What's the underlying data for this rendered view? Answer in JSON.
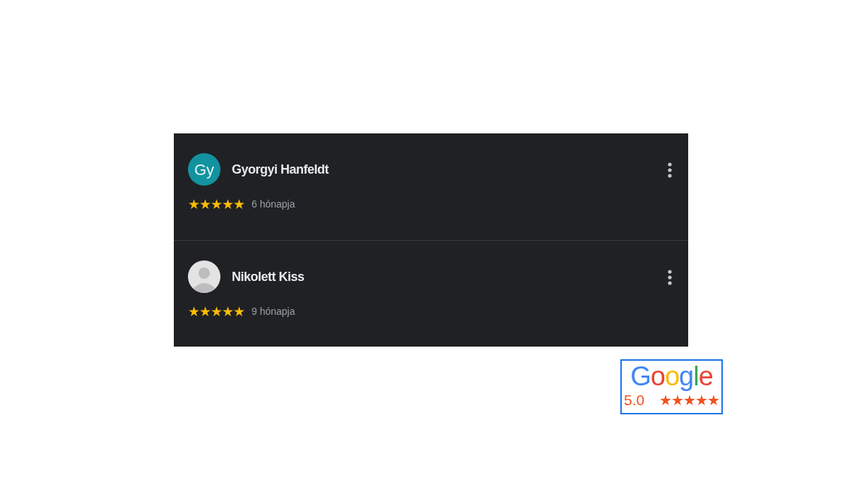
{
  "reviews": [
    {
      "name": "Gyorgyi Hanfeldt",
      "avatar": {
        "kind": "initials",
        "text": "Gy"
      },
      "stars": 5,
      "time": "6 hónapja"
    },
    {
      "name": "Nikolett Kiss",
      "avatar": {
        "kind": "silhouette"
      },
      "stars": 5,
      "time": "9 hónapja"
    }
  ],
  "badge": {
    "logo": "Google",
    "rating": "5.0",
    "stars": 5
  }
}
